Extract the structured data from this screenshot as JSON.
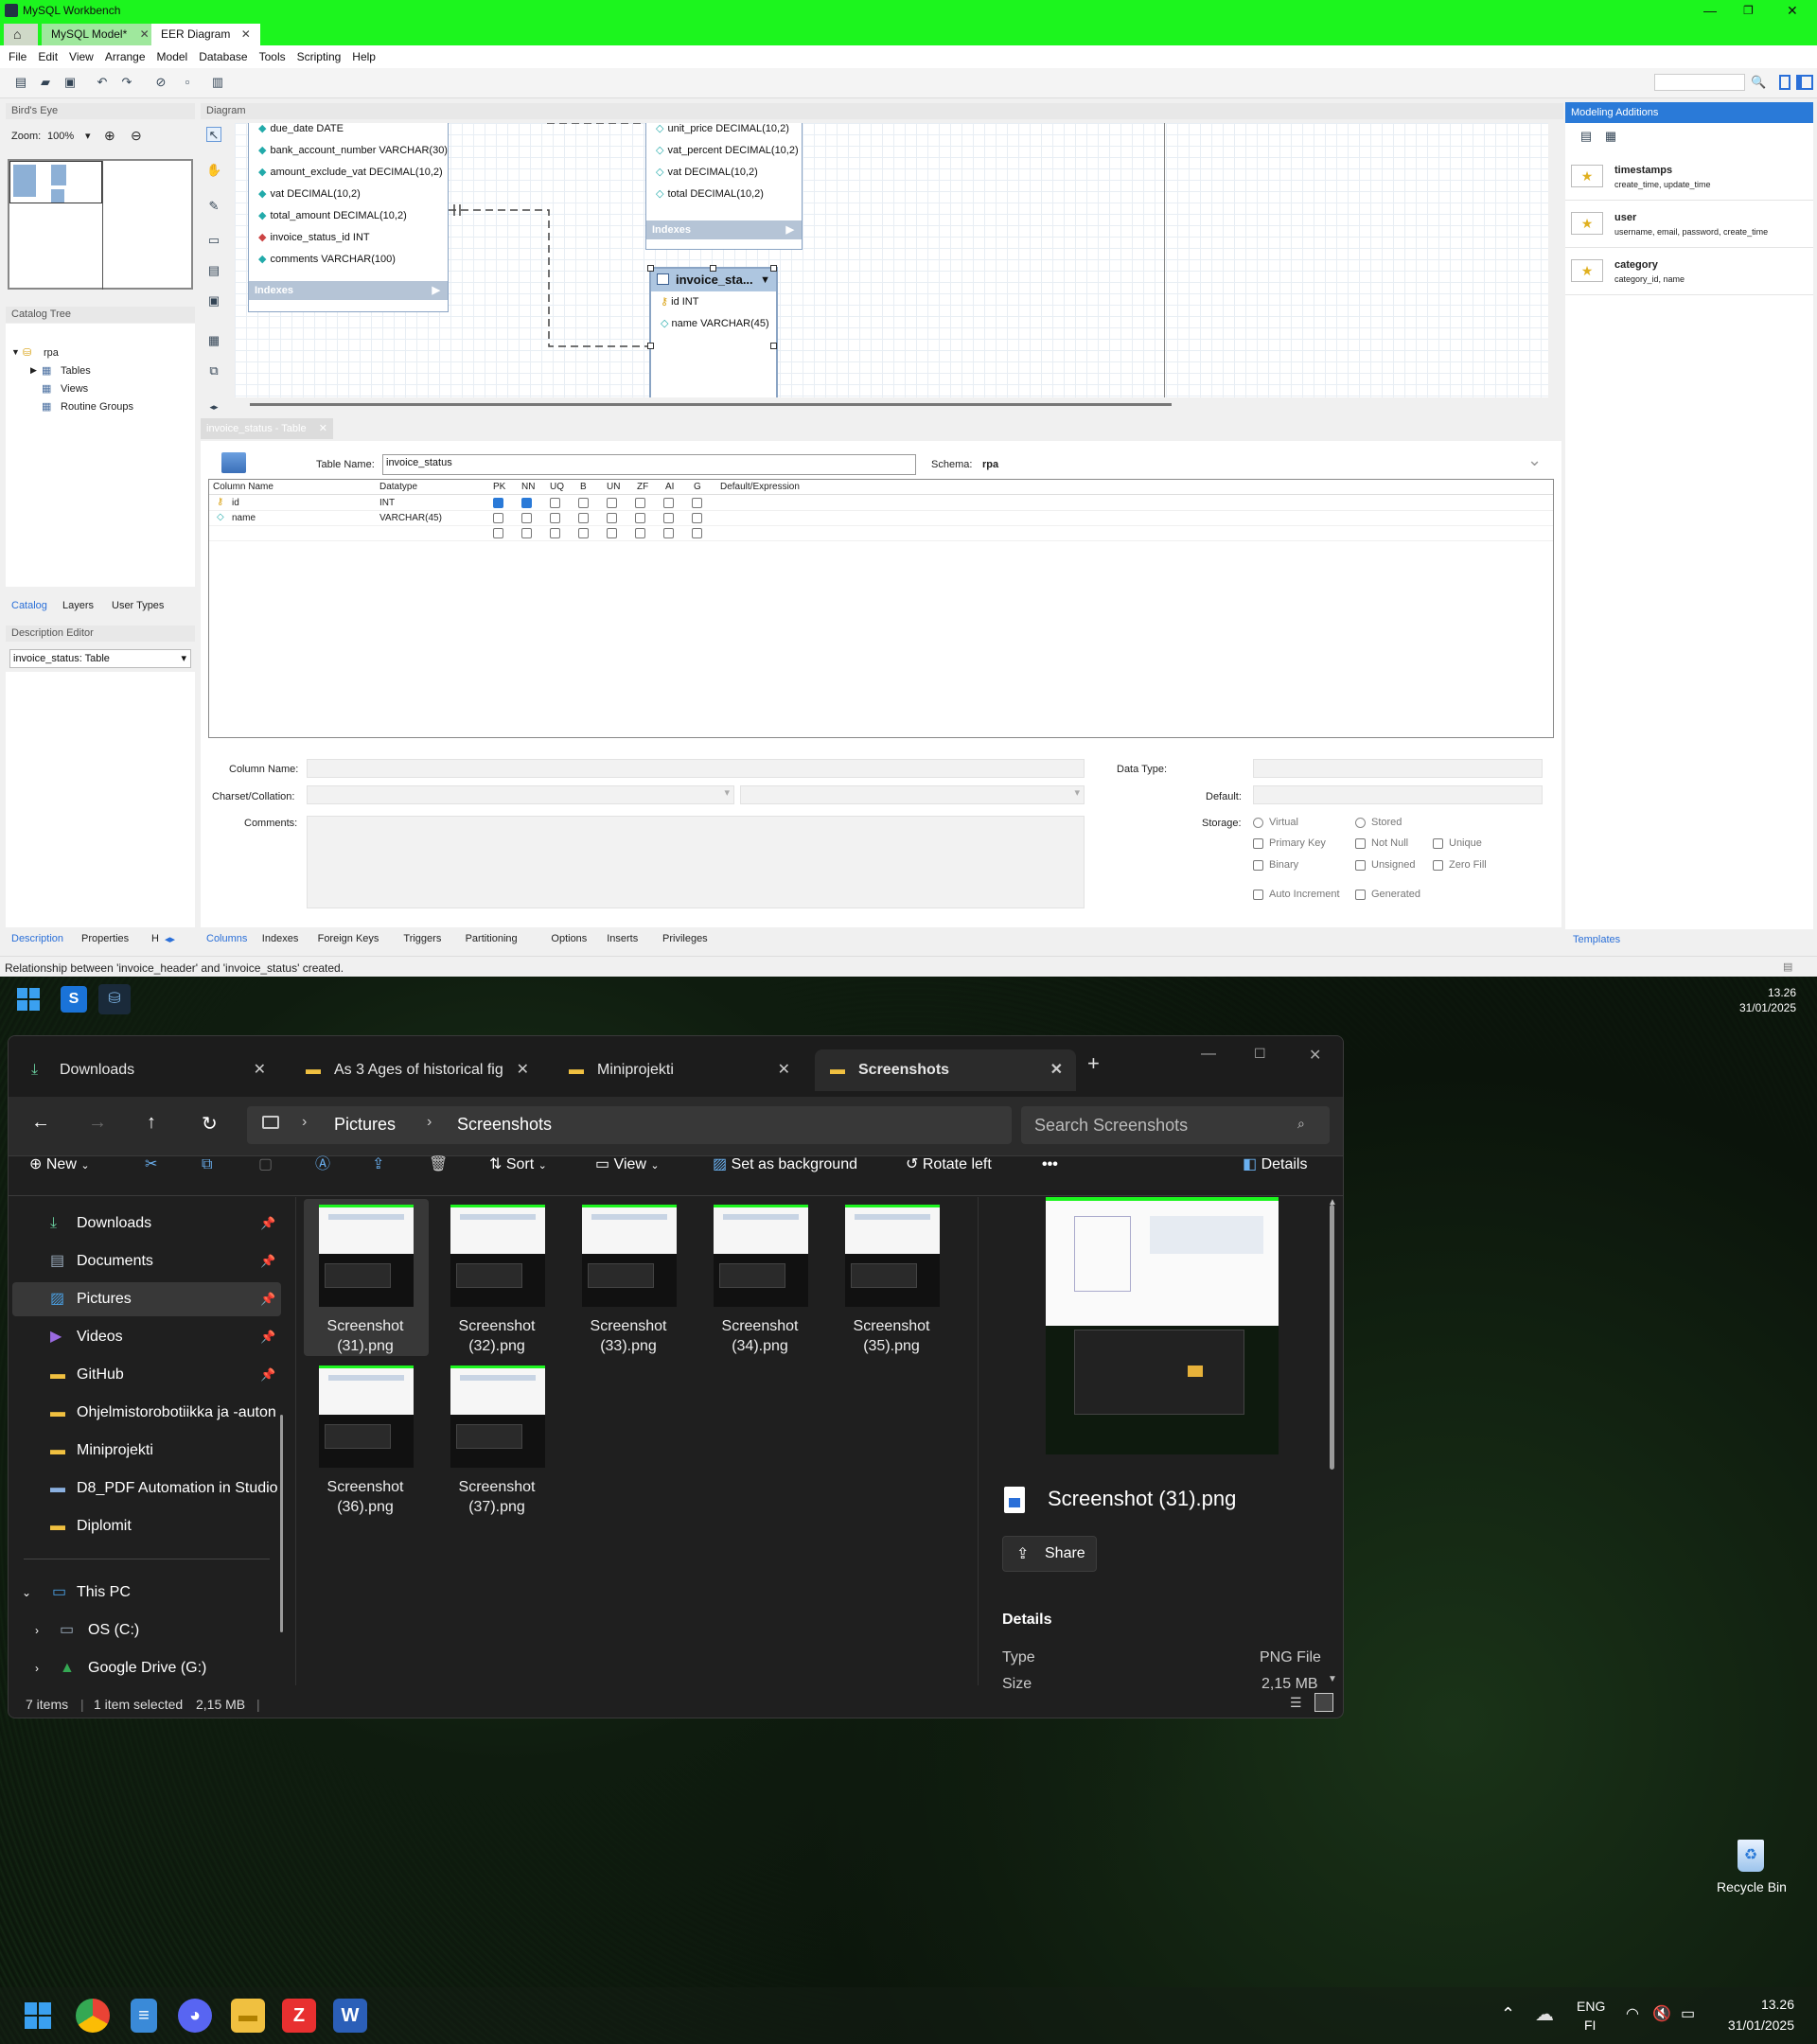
{
  "workbench": {
    "title": "MySQL Workbench",
    "tabs": [
      "MySQL Model*",
      "EER Diagram"
    ],
    "menu": [
      "File",
      "Edit",
      "View",
      "Arrange",
      "Model",
      "Database",
      "Tools",
      "Scripting",
      "Help"
    ],
    "birds_eye": "Bird's Eye",
    "diagram": "Diagram",
    "zoom_label": "Zoom:",
    "zoom_value": "100%",
    "catalog_tree": "Catalog Tree",
    "catalog": {
      "schema": "rpa",
      "items": [
        "Tables",
        "Views",
        "Routine Groups"
      ]
    },
    "left_tabs": [
      "Catalog",
      "Layers",
      "User Types"
    ],
    "description_editor": "Description Editor",
    "desc_select": "invoice_status: Table",
    "bottom_left_tabs": [
      "Description",
      "Properties",
      "H"
    ],
    "entity_header": {
      "rows": [
        "due_date DATE",
        "bank_account_number VARCHAR(30)",
        "amount_exclude_vat DECIMAL(10,2)",
        "vat DECIMAL(10,2)",
        "total_amount DECIMAL(10,2)",
        "invoice_status_id INT",
        "comments VARCHAR(100)"
      ],
      "indexes": "Indexes"
    },
    "entity_lines": {
      "rows": [
        "unit_price DECIMAL(10,2)",
        "vat_percent DECIMAL(10,2)",
        "vat DECIMAL(10,2)",
        "total DECIMAL(10,2)"
      ],
      "indexes": "Indexes"
    },
    "entity_status": {
      "title": "invoice_sta...",
      "rows": [
        "id INT",
        "name VARCHAR(45)"
      ]
    },
    "editor_tab": "invoice_status - Table",
    "table_name_label": "Table Name:",
    "table_name": "invoice_status",
    "schema_label": "Schema:",
    "schema": "rpa",
    "grid_headers": [
      "Column Name",
      "Datatype",
      "PK",
      "NN",
      "UQ",
      "B",
      "UN",
      "ZF",
      "AI",
      "G",
      "Default/Expression"
    ],
    "grid_rows": [
      {
        "name": "id",
        "type": "INT",
        "pk": true,
        "nn": true
      },
      {
        "name": "name",
        "type": "VARCHAR(45)",
        "pk": false,
        "nn": false
      }
    ],
    "detail": {
      "column_name": "Column Name:",
      "charset": "Charset/Collation:",
      "comments": "Comments:",
      "data_type": "Data Type:",
      "default": "Default:",
      "storage": "Storage:",
      "opts": [
        "Virtual",
        "Stored",
        "Primary Key",
        "Not Null",
        "Unique",
        "Binary",
        "Unsigned",
        "Zero Fill",
        "Auto Increment",
        "Generated"
      ]
    },
    "editor_tabs": [
      "Columns",
      "Indexes",
      "Foreign Keys",
      "Triggers",
      "Partitioning",
      "Options",
      "Inserts",
      "Privileges"
    ],
    "modeling_additions": "Modeling Additions",
    "templates": [
      {
        "name": "timestamps",
        "fields": "create_time, update_time"
      },
      {
        "name": "user",
        "fields": "username, email, password, create_time"
      },
      {
        "name": "category",
        "fields": "category_id, name"
      }
    ],
    "templates_tab": "Templates",
    "status": "Relationship between 'invoice_header' and 'invoice_status' created."
  },
  "top_clock": {
    "time": "13.26",
    "date": "31/01/2025"
  },
  "explorer": {
    "tabs": [
      "Downloads",
      "As 3 Ages of historical fig",
      "Miniprojekti",
      "Screenshots"
    ],
    "breadcrumb": [
      "Pictures",
      "Screenshots"
    ],
    "search_placeholder": "Search Screenshots",
    "toolbar": {
      "new": "New",
      "sort": "Sort",
      "view": "View",
      "set_bg": "Set as background",
      "rotate": "Rotate left",
      "details": "Details"
    },
    "nav": [
      {
        "label": "Downloads",
        "pinned": true
      },
      {
        "label": "Documents",
        "pinned": true
      },
      {
        "label": "Pictures",
        "pinned": true
      },
      {
        "label": "Videos",
        "pinned": true
      },
      {
        "label": "GitHub",
        "pinned": true
      },
      {
        "label": "Ohjelmistorobotiikka ja -auton"
      },
      {
        "label": "Miniprojekti"
      },
      {
        "label": "D8_PDF Automation in Studio"
      },
      {
        "label": "Diplomit"
      }
    ],
    "thispc": "This PC",
    "drives": [
      "OS (C:)",
      "Google Drive (G:)"
    ],
    "files": [
      {
        "l1": "Screenshot",
        "l2": "(31).png"
      },
      {
        "l1": "Screenshot",
        "l2": "(32).png"
      },
      {
        "l1": "Screenshot",
        "l2": "(33).png"
      },
      {
        "l1": "Screenshot",
        "l2": "(34).png"
      },
      {
        "l1": "Screenshot",
        "l2": "(35).png"
      },
      {
        "l1": "Screenshot",
        "l2": "(36).png"
      },
      {
        "l1": "Screenshot",
        "l2": "(37).png"
      }
    ],
    "preview": {
      "filename": "Screenshot (31).png",
      "share": "Share",
      "details_title": "Details",
      "type_label": "Type",
      "type_value": "PNG File",
      "size_label": "Size",
      "size_value": "2,15 MB"
    },
    "status": {
      "items": "7 items",
      "selected": "1 item selected",
      "size": "2,15 MB"
    }
  },
  "desktop": {
    "recycle_bin": "Recycle Bin"
  },
  "taskbar": {
    "lang1": "ENG",
    "lang2": "FI",
    "time": "13.26",
    "date": "31/01/2025"
  }
}
